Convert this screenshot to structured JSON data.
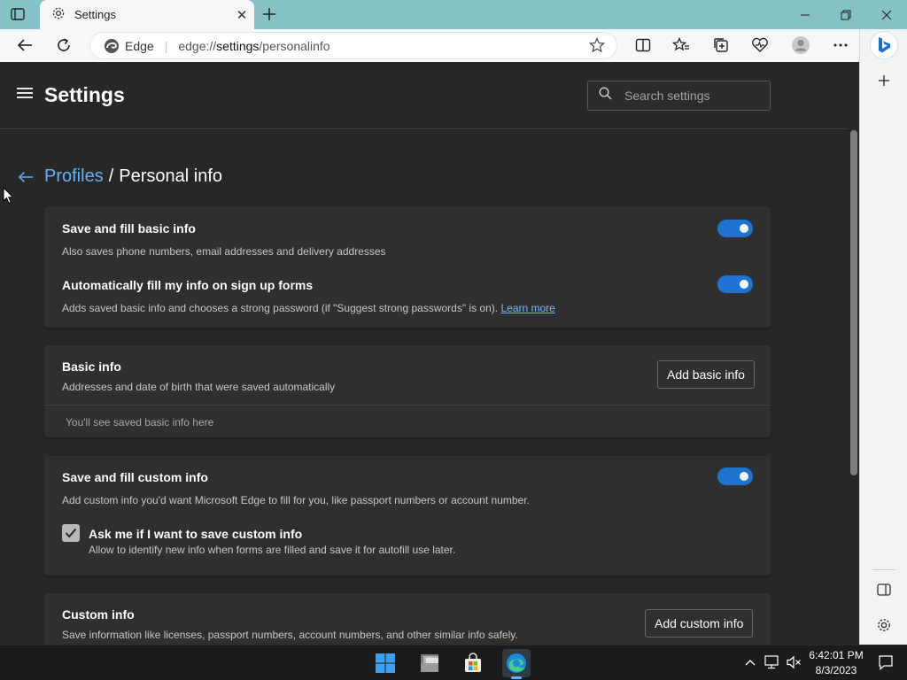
{
  "browser": {
    "tab_title": "Settings",
    "address_scheme": "Edge",
    "address_url_prefix": "edge://",
    "address_url_host": "settings",
    "address_url_path": "/personalinfo"
  },
  "settings": {
    "title": "Settings",
    "search_placeholder": "Search settings"
  },
  "breadcrumb": {
    "parent": "Profiles",
    "separator": "/",
    "current": "Personal info"
  },
  "cards": {
    "fill": {
      "row1_title": "Save and fill basic info",
      "row1_desc": "Also saves phone numbers, email addresses and delivery addresses",
      "row1_enabled": true,
      "row2_title": "Automatically fill my info on sign up forms",
      "row2_desc": "Adds saved basic info and chooses a strong password (if \"Suggest strong passwords\" is on).",
      "row2_link": "Learn more",
      "row2_enabled": true
    },
    "basic": {
      "title": "Basic info",
      "desc": "Addresses and date of birth that were saved automatically",
      "button": "Add basic info",
      "empty": "You'll see saved basic info here"
    },
    "custom_fill": {
      "title": "Save and fill custom info",
      "desc": "Add custom info you'd want Microsoft Edge to fill for you, like passport numbers or account number.",
      "enabled": true,
      "check_title": "Ask me if I want to save custom info",
      "check_desc": "Allow to identify new info when forms are filled and save it for autofill use later.",
      "checked": true
    },
    "custom": {
      "title": "Custom info",
      "desc": "Save information like licenses, passport numbers, account numbers, and other similar info safely.",
      "button": "Add custom info"
    }
  },
  "taskbar": {
    "time": "6:42:01 PM",
    "date": "8/3/2023"
  },
  "colors": {
    "accent": "#1f74d2",
    "link": "#60b1ff",
    "tab_strip": "#85c1c6"
  }
}
